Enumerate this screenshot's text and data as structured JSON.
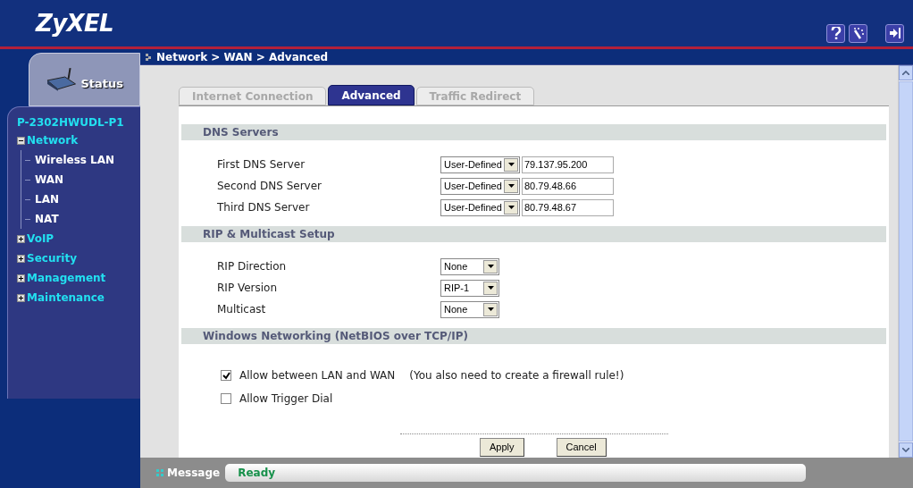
{
  "header": {
    "logo": "ZyXEL"
  },
  "breadcrumb": "Network > WAN > Advanced",
  "sidebar": {
    "status_tab": "Status",
    "device": "P-2302HWUDL-P1",
    "tree": [
      {
        "label": "Network",
        "expanded": true,
        "children": [
          {
            "label": "Wireless LAN"
          },
          {
            "label": "WAN"
          },
          {
            "label": "LAN"
          },
          {
            "label": "NAT"
          }
        ]
      },
      {
        "label": "VoIP",
        "expanded": false
      },
      {
        "label": "Security",
        "expanded": false
      },
      {
        "label": "Management",
        "expanded": false
      },
      {
        "label": "Maintenance",
        "expanded": false
      }
    ]
  },
  "tabs": [
    {
      "label": "Internet Connection",
      "selected": false
    },
    {
      "label": "Advanced",
      "selected": true
    },
    {
      "label": "Traffic Redirect",
      "selected": false
    }
  ],
  "sections": [
    {
      "title": "DNS Servers",
      "rows": [
        {
          "kind": "select_input",
          "label": "First DNS Server",
          "select": "User-Defined",
          "value": "79.137.95.200"
        },
        {
          "kind": "select_input",
          "label": "Second DNS Server",
          "select": "User-Defined",
          "value": "80.79.48.66"
        },
        {
          "kind": "select_input",
          "label": "Third DNS Server",
          "select": "User-Defined",
          "value": "80.79.48.67"
        }
      ]
    },
    {
      "title": "RIP & Multicast Setup",
      "rows": [
        {
          "kind": "select",
          "label": "RIP Direction",
          "select": "None"
        },
        {
          "kind": "select",
          "label": "RIP Version",
          "select": "RIP-1"
        },
        {
          "kind": "select",
          "label": "Multicast",
          "select": "None"
        }
      ]
    },
    {
      "title": "Windows Networking (NetBIOS over TCP/IP)",
      "rows": [
        {
          "kind": "checkbox",
          "label": "Allow between LAN and WAN",
          "checked": true,
          "note": "(You also need to create a firewall rule!)"
        },
        {
          "kind": "checkbox",
          "label": "Allow Trigger Dial",
          "checked": false
        }
      ]
    }
  ],
  "buttons": [
    "Apply",
    "Cancel"
  ],
  "status_bar": {
    "label": "Message",
    "value": "Ready"
  }
}
